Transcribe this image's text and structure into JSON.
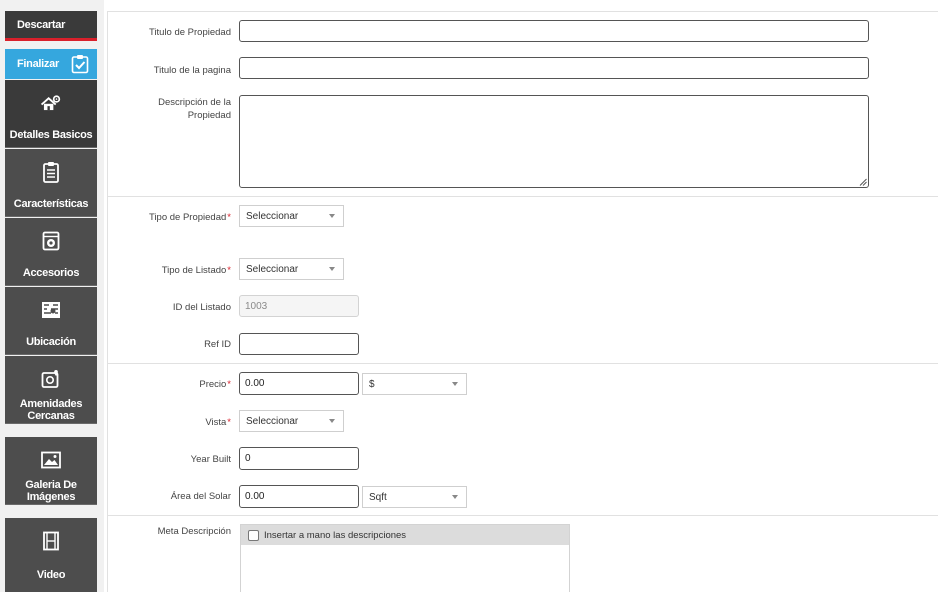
{
  "sidebar": {
    "discard_label": "Descartar",
    "finish_label": "Finalizar",
    "items": [
      {
        "label": "Detalles Basicos",
        "icon": "house-gear-icon"
      },
      {
        "label": "Características",
        "icon": "clipboard-icon"
      },
      {
        "label": "Accesorios",
        "icon": "washer-icon"
      },
      {
        "label": "Ubicación",
        "icon": "map-icon"
      },
      {
        "label": "Amenidades Cercanas",
        "icon": "location-camera-icon"
      },
      {
        "label": "Galeria De Imágenes",
        "icon": "image-icon"
      },
      {
        "label": "Video",
        "icon": "film-icon"
      }
    ]
  },
  "form": {
    "property_title": {
      "label": "Titulo de Propiedad",
      "value": ""
    },
    "page_title": {
      "label": "Titulo de la pagina",
      "value": ""
    },
    "property_description": {
      "label": "Descripción de la Propiedad",
      "value": ""
    },
    "property_type": {
      "label": "Tipo de Propiedad",
      "value": "Seleccionar"
    },
    "listing_type": {
      "label": "Tipo de Listado",
      "value": "Seleccionar"
    },
    "listing_id": {
      "label": "ID del Listado",
      "value": "1003"
    },
    "ref_id": {
      "label": "Ref ID",
      "value": ""
    },
    "price": {
      "label": "Precio",
      "value": "0.00",
      "currency": "$"
    },
    "view": {
      "label": "Vista",
      "value": "Seleccionar"
    },
    "year_built": {
      "label": "Year Built",
      "value": "0"
    },
    "lot_area": {
      "label": "Área del Solar",
      "value": "0.00",
      "unit": "Sqft"
    },
    "meta_description": {
      "label": "Meta Descripción",
      "checkbox_label": "Insertar a mano las descripciones",
      "checked": false
    }
  },
  "required_marker": "*",
  "colors": {
    "accent": "#35a7de",
    "required": "#d9202b",
    "sidebar": "#4d4d4d"
  }
}
